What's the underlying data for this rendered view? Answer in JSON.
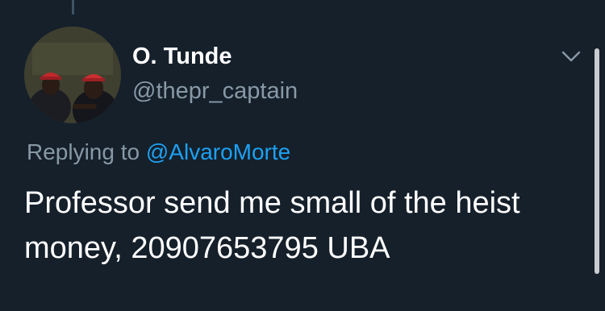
{
  "tweet": {
    "display_name": "O. Tunde",
    "handle": "@thepr_captain",
    "replying_prefix": "Replying to",
    "replying_to_handle": "@AlvaroMorte",
    "text": "Professor send me small of the heist money, 20907653795 UBA"
  },
  "icons": {
    "menu": "chevron-down-icon"
  },
  "colors": {
    "background": "#15202b",
    "primary_text": "#ffffff",
    "secondary_text": "#8899a6",
    "link": "#1da1f2",
    "thread_line": "#3d5466"
  }
}
